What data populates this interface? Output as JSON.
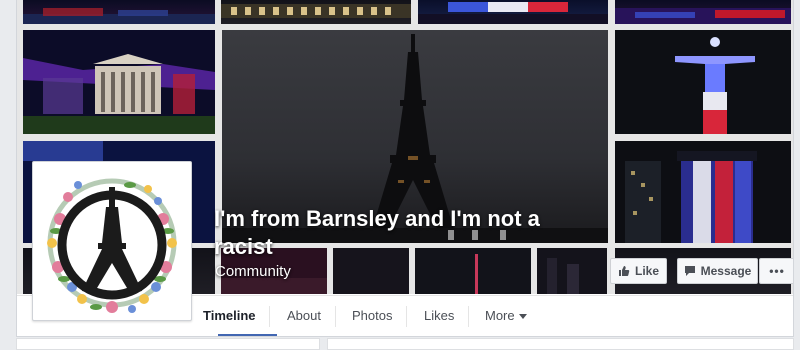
{
  "page": {
    "title": "I'm from Barnsley and I'm not a racist",
    "category": "Community"
  },
  "actions": {
    "like_label": "Like",
    "message_label": "Message",
    "more_label": "•••"
  },
  "tabs": [
    {
      "label": "Timeline"
    },
    {
      "label": "About"
    },
    {
      "label": "Photos"
    },
    {
      "label": "Likes"
    },
    {
      "label": "More"
    }
  ],
  "icons": {
    "like": "thumbs-up-icon",
    "message": "message-icon",
    "more_tab": "caret-down-icon"
  },
  "colors": {
    "accent": "#4267b2",
    "button_bg": "#f6f7f9",
    "page_bg": "#e9ebee"
  }
}
